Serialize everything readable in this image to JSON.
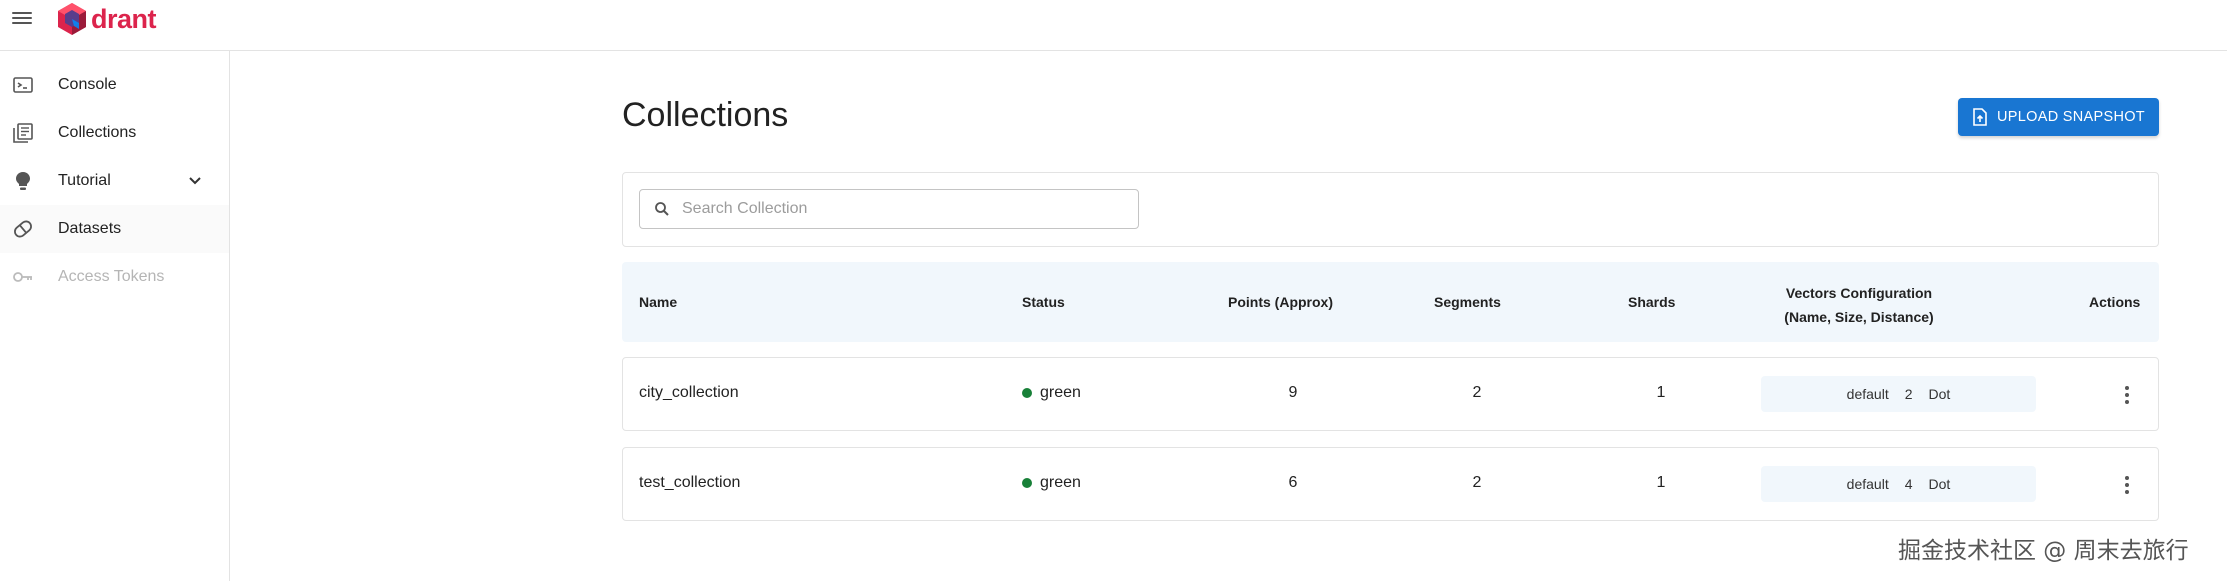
{
  "brand": {
    "logo_text": "drant",
    "logo_color": "#dc244c"
  },
  "sidebar": {
    "items": [
      {
        "label": "Console",
        "icon": "terminal-icon"
      },
      {
        "label": "Collections",
        "icon": "library-books-icon"
      },
      {
        "label": "Tutorial",
        "icon": "lightbulb-icon"
      },
      {
        "label": "Datasets",
        "icon": "dataset-icon"
      },
      {
        "label": "Access Tokens",
        "icon": "key-icon",
        "disabled": true
      }
    ]
  },
  "main": {
    "title": "Collections",
    "upload_label": "UPLOAD SNAPSHOT",
    "search": {
      "placeholder": "Search Collection",
      "value": ""
    },
    "table": {
      "headers": {
        "name": "Name",
        "status": "Status",
        "points": "Points (Approx)",
        "segments": "Segments",
        "shards": "Shards",
        "vectors_line1": "Vectors Configuration",
        "vectors_line2": "(Name, Size, Distance)",
        "actions": "Actions"
      },
      "rows": [
        {
          "name": "city_collection",
          "status": "green",
          "points": "9",
          "segments": "2",
          "shards": "1",
          "vector_name": "default",
          "vector_size": "2",
          "vector_distance": "Dot"
        },
        {
          "name": "test_collection",
          "status": "green",
          "points": "6",
          "segments": "2",
          "shards": "1",
          "vector_name": "default",
          "vector_size": "4",
          "vector_distance": "Dot"
        }
      ]
    }
  },
  "colors": {
    "primary": "#1976d2",
    "status_green": "#188038",
    "header_bg": "#f1f7fc"
  },
  "watermark": "掘金技术社区 @ 周末去旅行"
}
